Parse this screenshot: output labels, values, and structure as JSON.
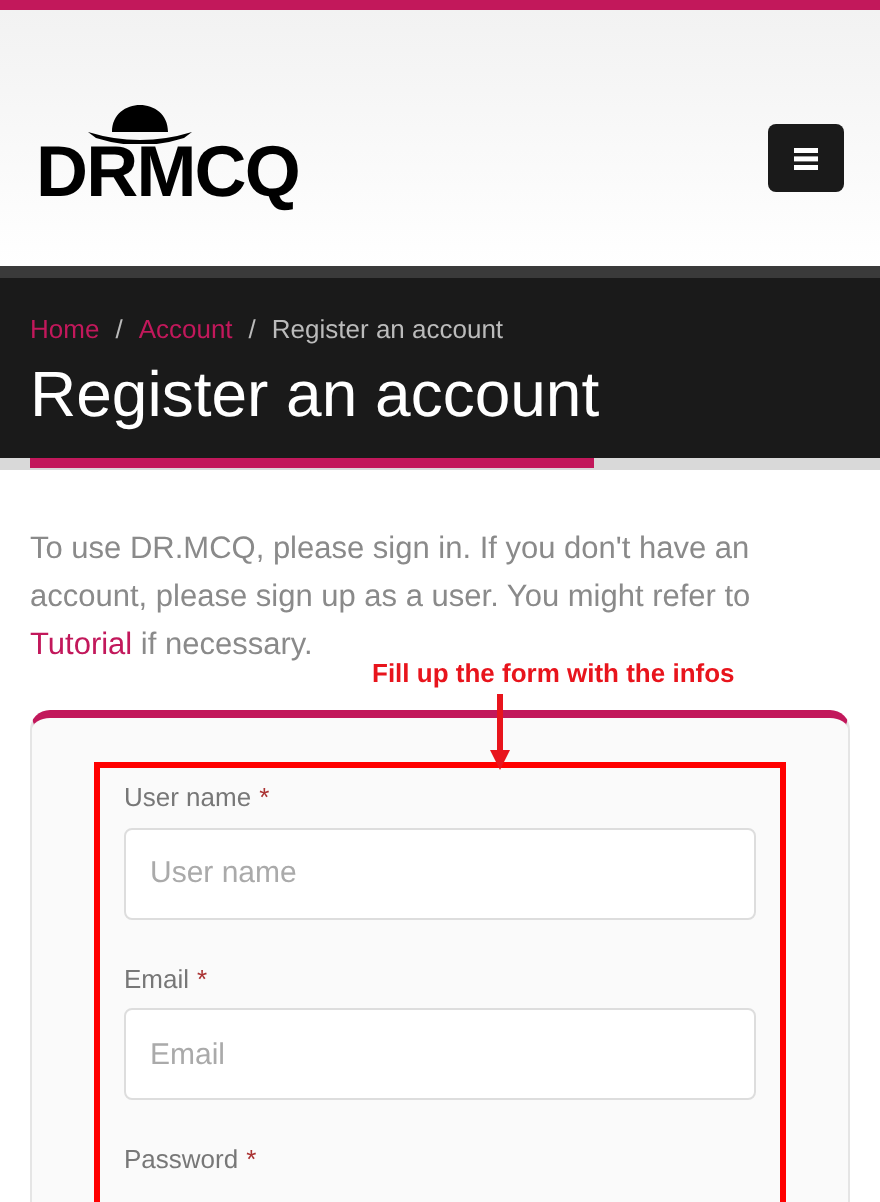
{
  "logo": {
    "text": "DRMCQ"
  },
  "breadcrumb": [
    {
      "label": "Home",
      "kind": "link"
    },
    {
      "label": "Account",
      "kind": "link"
    },
    {
      "label": "Register an account",
      "kind": "current"
    }
  ],
  "breadcrumb_separator": "/",
  "page_title": "Register an account",
  "intro": {
    "before": "To use DR.MCQ, please sign in. If you don't have an account, please sign up as a user. You might refer to ",
    "link": "Tutorial",
    "after": " if necessary."
  },
  "annotation": "Fill up the form with the infos",
  "form": {
    "fields": [
      {
        "label": "User name",
        "required_mark": "*",
        "placeholder": "User name"
      },
      {
        "label": "Email",
        "required_mark": "*",
        "placeholder": "Email"
      },
      {
        "label": "Password",
        "required_mark": "*"
      }
    ]
  }
}
